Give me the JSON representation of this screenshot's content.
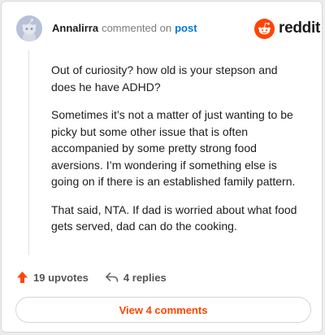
{
  "comment": {
    "username": "Annalirra",
    "action_text": "commented on",
    "post_link": "post",
    "paragraphs": [
      "Out of curiosity? how old is your stepson and does he have ADHD?",
      "Sometimes it’s not a matter of just wanting to be picky but some other issue that is often accompanied by some pretty strong food aversions. I’m wondering if something else is going on if there is an established family pattern.",
      "That said, NTA. If dad is worried about what food gets served, dad can do the cooking."
    ]
  },
  "brand": {
    "wordmark": "reddit",
    "color": "#ff4500"
  },
  "footer": {
    "upvotes_label": "19 upvotes",
    "replies_label": "4 replies"
  },
  "view_comments_label": "View 4 comments",
  "icons": {
    "avatar": "snoo-avatar-icon",
    "logo": "reddit-logo-icon",
    "upvote": "upvote-arrow-icon",
    "reply": "reply-arrow-icon"
  }
}
